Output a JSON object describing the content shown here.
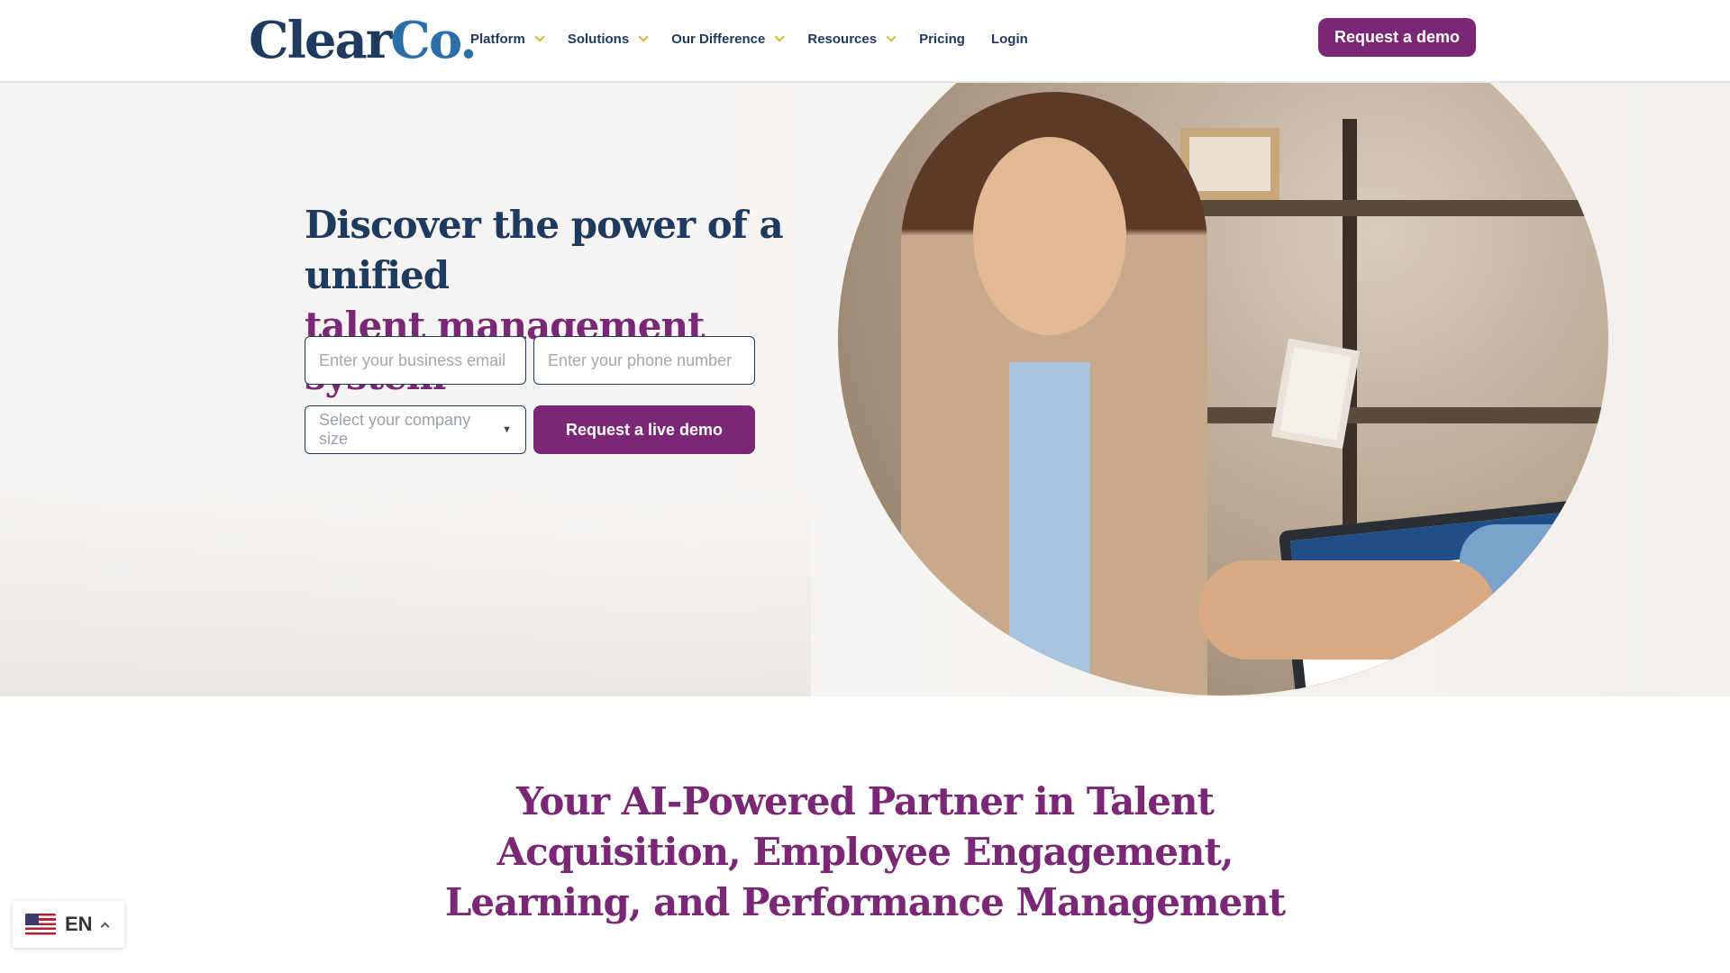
{
  "header": {
    "logo_part1": "Clear",
    "logo_part2": "Co",
    "logo_dot": ".",
    "nav": [
      {
        "label": "Platform",
        "has_dropdown": true
      },
      {
        "label": "Solutions",
        "has_dropdown": true
      },
      {
        "label": "Our Difference",
        "has_dropdown": true
      },
      {
        "label": "Resources",
        "has_dropdown": true
      },
      {
        "label": "Pricing",
        "has_dropdown": false
      },
      {
        "label": "Login",
        "has_dropdown": false
      }
    ],
    "cta_label": "Request a demo"
  },
  "hero": {
    "title_line1": "Discover the power of a unified",
    "title_line2": "talent management system",
    "email_placeholder": "Enter your business email",
    "phone_placeholder": "Enter your phone number",
    "company_size_placeholder": "Select your company size",
    "submit_label": "Request a live demo"
  },
  "section": {
    "title": "Your AI-Powered Partner in Talent Acquisition, Employee Engagement, Learning, and Performance Management"
  },
  "language": {
    "code": "EN",
    "flag_icon": "us-flag-icon"
  },
  "colors": {
    "navy": "#1e3a5f",
    "purple": "#7a2776",
    "gold": "#d9b531"
  }
}
